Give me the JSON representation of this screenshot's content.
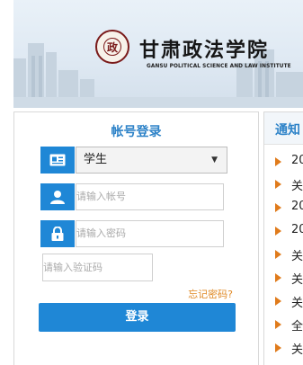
{
  "school": {
    "name_cn": "甘肃政法学院",
    "name_en": "GANSU POLITICAL SCIENCE AND LAW INSTITUTE",
    "emblem_glyph": "政"
  },
  "login": {
    "title": "帐号登录",
    "role_selected": "学生",
    "account_placeholder": "请输入帐号",
    "password_placeholder": "请输入密码",
    "captcha_placeholder": "请输入验证码",
    "forgot_link": "忘记密码?",
    "login_button": "登录"
  },
  "notice": {
    "title": "通知",
    "items": [
      {
        "text": "20"
      },
      {
        "text": "关"
      },
      {
        "text": "20"
      },
      {
        "text": "20"
      },
      {
        "text": "关"
      },
      {
        "text": "关"
      },
      {
        "text": "关"
      },
      {
        "text": "全"
      },
      {
        "text": "关"
      }
    ]
  },
  "colors": {
    "accent": "#1f87d6",
    "title_blue": "#2e83c8",
    "forgot_orange": "#e08a26",
    "bullet_orange": "#e07b1b",
    "emblem_red": "#7a1b1b"
  }
}
